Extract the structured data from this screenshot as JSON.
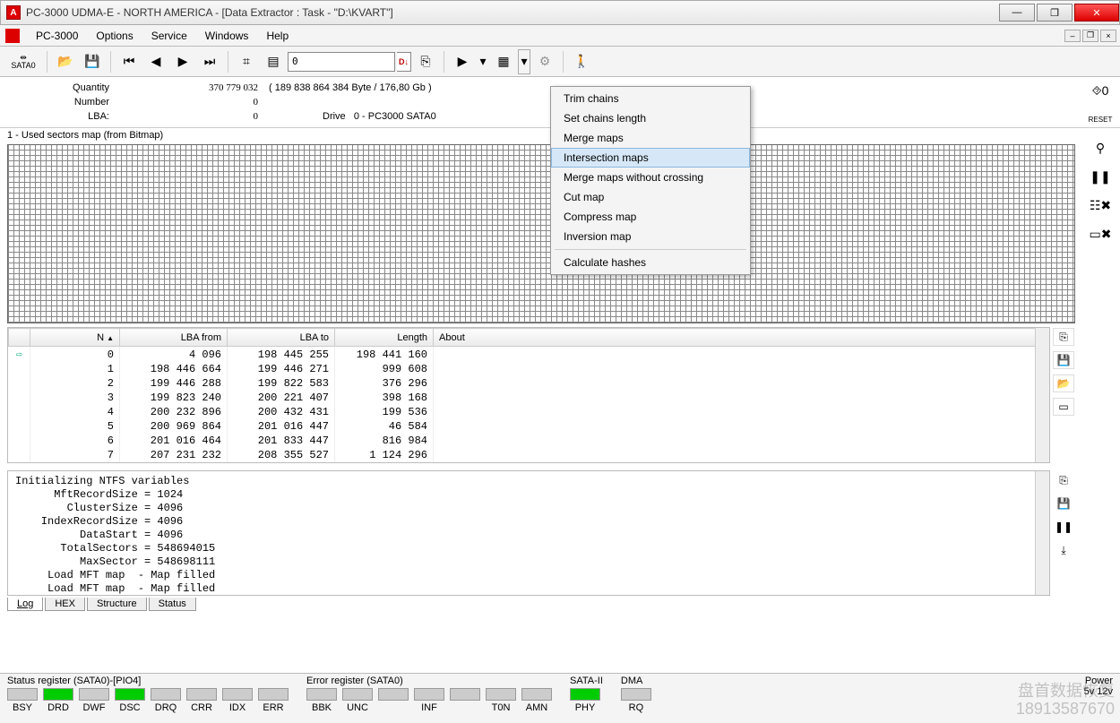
{
  "window": {
    "title": "PC-3000 UDMA-E - NORTH AMERICA - [Data Extractor : Task - \"D:\\KVART\"]"
  },
  "menubar": {
    "app": "PC-3000",
    "items": [
      "Options",
      "Service",
      "Windows",
      "Help"
    ]
  },
  "toolbar": {
    "sata_label": "SATA0",
    "lba_value": "0",
    "lba_flag": "D↓"
  },
  "info": {
    "quantity_label": "Quantity",
    "quantity_value": "370 779 032",
    "quantity_extra": "( 189 838 864 384 Byte /  176,80 Gb )",
    "number_label": "Number",
    "number_value": "0",
    "lba_label": "LBA:",
    "lba_value": "0",
    "drive_label": "Drive",
    "drive_value": "0 - PC3000 SATA0"
  },
  "map": {
    "header": "1 - Used sectors map (from Bitmap)"
  },
  "context_menu": {
    "items": [
      {
        "label": "Trim chains"
      },
      {
        "label": "Set chains length"
      },
      {
        "label": "Merge maps"
      },
      {
        "label": "Intersection maps",
        "hl": true
      },
      {
        "label": "Merge maps without crossing"
      },
      {
        "label": "Cut map"
      },
      {
        "label": "Compress map"
      },
      {
        "label": "Inversion map"
      },
      {
        "sep": true
      },
      {
        "label": "Calculate hashes"
      }
    ]
  },
  "table": {
    "headers": {
      "n": "N",
      "from": "LBA from",
      "to": "LBA to",
      "len": "Length",
      "about": "About",
      "sort": "▲"
    },
    "rows": [
      {
        "n": "0",
        "from": "4 096",
        "to": "198 445 255",
        "len": "198 441 160",
        "cur": true
      },
      {
        "n": "1",
        "from": "198 446 664",
        "to": "199 446 271",
        "len": "999 608"
      },
      {
        "n": "2",
        "from": "199 446 288",
        "to": "199 822 583",
        "len": "376 296"
      },
      {
        "n": "3",
        "from": "199 823 240",
        "to": "200 221 407",
        "len": "398 168"
      },
      {
        "n": "4",
        "from": "200 232 896",
        "to": "200 432 431",
        "len": "199 536"
      },
      {
        "n": "5",
        "from": "200 969 864",
        "to": "201 016 447",
        "len": "46 584"
      },
      {
        "n": "6",
        "from": "201 016 464",
        "to": "201 833 447",
        "len": "816 984"
      },
      {
        "n": "7",
        "from": "207 231 232",
        "to": "208 355 527",
        "len": "1 124 296"
      }
    ]
  },
  "log": {
    "lines": [
      "Initializing NTFS variables",
      "      MftRecordSize = 1024",
      "        ClusterSize = 4096",
      "    IndexRecordSize = 4096",
      "          DataStart = 4096",
      "       TotalSectors = 548694015",
      "          MaxSector = 548698111",
      "     Load MFT map  - Map filled",
      "     Load MFT map  - Map filled"
    ]
  },
  "bottom_tabs": {
    "items": [
      "Log",
      "HEX",
      "Structure",
      "Status"
    ],
    "active": 0
  },
  "status": {
    "status_reg_title": "Status register (SATA0)-[PIO4]",
    "error_reg_title": "Error register (SATA0)",
    "sata_title": "SATA-II",
    "dma_title": "DMA",
    "power_title": "Power",
    "power_val": "5v  12v",
    "status_regs": [
      {
        "label": "BSY",
        "on": false
      },
      {
        "label": "DRD",
        "on": true
      },
      {
        "label": "DWF",
        "on": false
      },
      {
        "label": "DSC",
        "on": true
      },
      {
        "label": "DRQ",
        "on": false
      },
      {
        "label": "CRR",
        "on": false
      },
      {
        "label": "IDX",
        "on": false
      },
      {
        "label": "ERR",
        "on": false
      }
    ],
    "error_regs": [
      {
        "label": "BBK",
        "on": false
      },
      {
        "label": "UNC",
        "on": false
      },
      {
        "label": "",
        "on": false
      },
      {
        "label": "INF",
        "on": false
      },
      {
        "label": "",
        "on": false
      },
      {
        "label": "T0N",
        "on": false
      },
      {
        "label": "AMN",
        "on": false
      }
    ],
    "sata_regs": [
      {
        "label": "PHY",
        "on": true
      }
    ],
    "dma_regs": [
      {
        "label": "RQ",
        "on": false
      }
    ]
  },
  "watermark": {
    "l1": "盘首数据恢复",
    "l2": "18913587670"
  }
}
